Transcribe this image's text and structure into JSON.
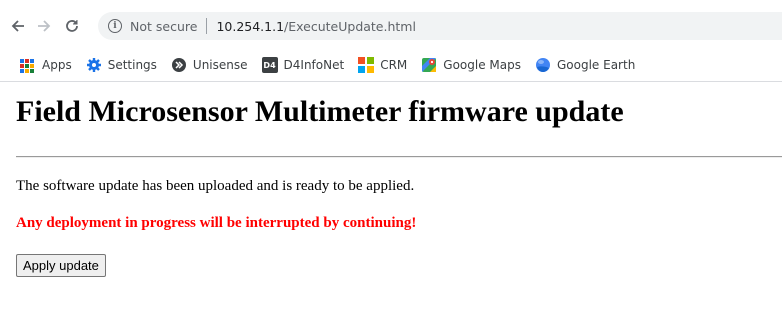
{
  "browser": {
    "security_label": "Not secure",
    "url_host": "10.254.1.1",
    "url_path": "/ExecuteUpdate.html",
    "bookmarks": [
      {
        "label": "Apps",
        "icon": "apps-grid-icon"
      },
      {
        "label": "Settings",
        "icon": "gear-icon"
      },
      {
        "label": "Unisense",
        "icon": "unisense-icon"
      },
      {
        "label": "D4InfoNet",
        "icon": "d4-icon",
        "icon_text": "D4"
      },
      {
        "label": "CRM",
        "icon": "crm-icon"
      },
      {
        "label": "Google Maps",
        "icon": "google-maps-icon"
      },
      {
        "label": "Google Earth",
        "icon": "google-earth-icon"
      }
    ]
  },
  "page": {
    "title": "Field Microsensor Multimeter firmware update",
    "message": "The software update has been uploaded and is ready to be applied.",
    "warning": "Any deployment in progress will be interrupted by continuing!",
    "apply_button_label": "Apply update"
  },
  "colors": {
    "warning_text": "#ff0000",
    "apps_blue": "#1a73e8",
    "settings_blue": "#1a73e8"
  }
}
